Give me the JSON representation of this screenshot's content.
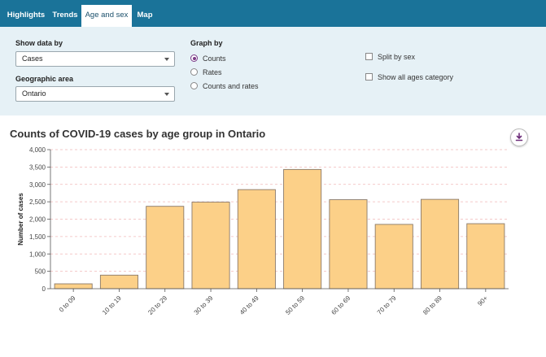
{
  "tabs": [
    {
      "label": "Highlights",
      "active": false
    },
    {
      "label": "Trends",
      "active": false
    },
    {
      "label": "Age and sex",
      "active": true
    },
    {
      "label": "Map",
      "active": false
    }
  ],
  "controls": {
    "show_data_by": {
      "label": "Show data by",
      "value": "Cases"
    },
    "geographic_area": {
      "label": "Geographic area",
      "value": "Ontario"
    },
    "graph_by": {
      "label": "Graph by",
      "options": [
        {
          "label": "Counts",
          "selected": true
        },
        {
          "label": "Rates",
          "selected": false
        },
        {
          "label": "Counts and rates",
          "selected": false
        }
      ]
    },
    "split_by_sex": {
      "label": "Split by sex",
      "checked": false
    },
    "show_all_ages": {
      "label": "Show all ages category",
      "checked": false
    }
  },
  "colors": {
    "tab_bar": "#1a7399",
    "controls_bg": "#e6f1f6",
    "bar_fill": "#fcd088",
    "bar_stroke": "#8a7a6a",
    "grid": "#f0b8b8",
    "radio_accent": "#7a3a86"
  },
  "download_icon": "download-icon",
  "chart_data": {
    "type": "bar",
    "title": "Counts of COVID-19 cases by age group in Ontario",
    "ylabel": "Number of cases",
    "xlabel": "",
    "categories": [
      "0 to 09",
      "10 to 19",
      "20 to 29",
      "30 to 39",
      "40 to 49",
      "50 to 59",
      "60 to 69",
      "70 to 79",
      "80 to 89",
      "90+"
    ],
    "values": [
      140,
      390,
      2370,
      2490,
      2850,
      3430,
      2560,
      1850,
      2570,
      1870
    ],
    "ylim": [
      0,
      4000
    ],
    "yticks": [
      0,
      500,
      1000,
      1500,
      2000,
      2500,
      3000,
      3500,
      4000
    ],
    "ytick_labels": [
      "0",
      "500",
      "1,000",
      "1,500",
      "2,000",
      "2,500",
      "3,000",
      "3,500",
      "4,000"
    ],
    "grid": true,
    "legend": "none"
  }
}
